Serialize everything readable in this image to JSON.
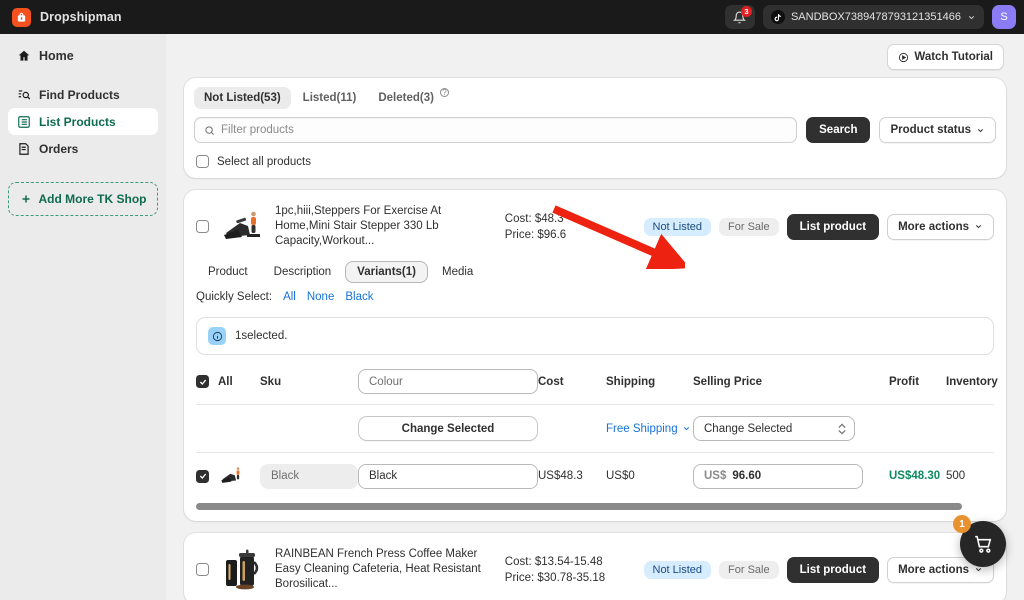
{
  "topbar": {
    "brand_name": "Dropshipman",
    "brand_icon": "bag-icon",
    "notification_icon": "bell-icon",
    "notification_count": "3",
    "store_name": "SANDBOX7389478793121351466",
    "store_icon": "tiktok-icon",
    "store_chevron": "chevron-down-icon",
    "avatar_initial": "S"
  },
  "sidebar": {
    "items": [
      {
        "label": "Home",
        "icon": "home-icon",
        "active": false
      },
      {
        "label": "Find Products",
        "icon": "search-list-icon",
        "active": false
      },
      {
        "label": "List Products",
        "icon": "list-icon",
        "active": true
      },
      {
        "label": "Orders",
        "icon": "orders-icon",
        "active": false
      }
    ],
    "add_shop_label": "Add More TK Shop",
    "add_shop_icon": "plus-icon"
  },
  "main": {
    "watch_tutorial_label": "Watch Tutorial",
    "watch_tutorial_icon": "play-circle-icon"
  },
  "filter": {
    "tabs": [
      {
        "label": "Not Listed(53)",
        "active": true,
        "help": false
      },
      {
        "label": "Listed(11)",
        "active": false,
        "help": false
      },
      {
        "label": "Deleted(3)",
        "active": false,
        "help": true
      }
    ],
    "help_glyph": "?",
    "search_icon": "search-icon",
    "search_placeholder": "Filter products",
    "search_value": "",
    "search_button": "Search",
    "product_status_label": "Product status",
    "product_status_chevron": "chevron-down-icon",
    "select_all_label": "Select all products"
  },
  "products": [
    {
      "title": "1pc,hiii,Steppers For Exercise At Home,Mini Stair Stepper 330 Lb Capacity,Workout...",
      "cost": "Cost: $48.3",
      "price": "Price: $96.6",
      "status_badge": "Not Listed",
      "sale_badge": "For Sale",
      "list_button": "List product",
      "more_actions": "More actions",
      "more_actions_chevron": "chevron-down-icon",
      "thumb_icon": "stepper-machine-image",
      "checked": false
    },
    {
      "title": "RAINBEAN French Press Coffee Maker Easy Cleaning Cafeteria, Heat Resistant Borosilicat...",
      "cost": "Cost: $13.54-15.48",
      "price": "Price: $30.78-35.18",
      "status_badge": "Not Listed",
      "sale_badge": "For Sale",
      "list_button": "List product",
      "more_actions": "More actions",
      "more_actions_chevron": "chevron-down-icon",
      "thumb_icon": "french-press-image",
      "checked": false
    }
  ],
  "variants_panel": {
    "subtabs": [
      {
        "label": "Product",
        "active": false
      },
      {
        "label": "Description",
        "active": false
      },
      {
        "label": "Variants(1)",
        "active": true
      },
      {
        "label": "Media",
        "active": false
      }
    ],
    "quick_select_label": "Quickly Select:",
    "quick_links": [
      "All",
      "None",
      "Black"
    ],
    "banner_icon": "info-icon",
    "banner_text": "1selected.",
    "columns": {
      "all": "All",
      "sku": "Sku",
      "colour_placeholder": "Colour",
      "colour_value": "",
      "cost": "Cost",
      "shipping": "Shipping",
      "selling_price": "Selling Price",
      "profit": "Profit",
      "inventory": "Inventory"
    },
    "bulk_row": {
      "change_selected_button": "Change Selected",
      "free_shipping_link": "Free Shipping",
      "free_shipping_chevron": "chevron-down-icon",
      "price_select_value": "Change Selected",
      "stepper_icon": "stepper-arrows-icon"
    },
    "rows": [
      {
        "checked": true,
        "thumb_icon": "stepper-machine-image",
        "sku_placeholder": "Black",
        "sku_value": "",
        "colour_value": "Black",
        "cost": "US$48.3",
        "shipping": "US$0",
        "price_currency": "US$",
        "price_value": "96.60",
        "profit": "US$48.30",
        "inventory": "500"
      }
    ],
    "header_checked": true
  },
  "annotation": {
    "arrow_color": "#ee2211",
    "arrow_icon": "red-pointer-arrow"
  },
  "cart": {
    "icon": "shopping-cart-icon",
    "badge": "1"
  },
  "colors": {
    "brand_orange": "#f4511e",
    "accent_green": "#0f6b4f",
    "link_blue": "#1773d6",
    "badge_blue_bg": "#d6edff",
    "profit_green": "#0f8a5f",
    "dark": "#303030"
  }
}
